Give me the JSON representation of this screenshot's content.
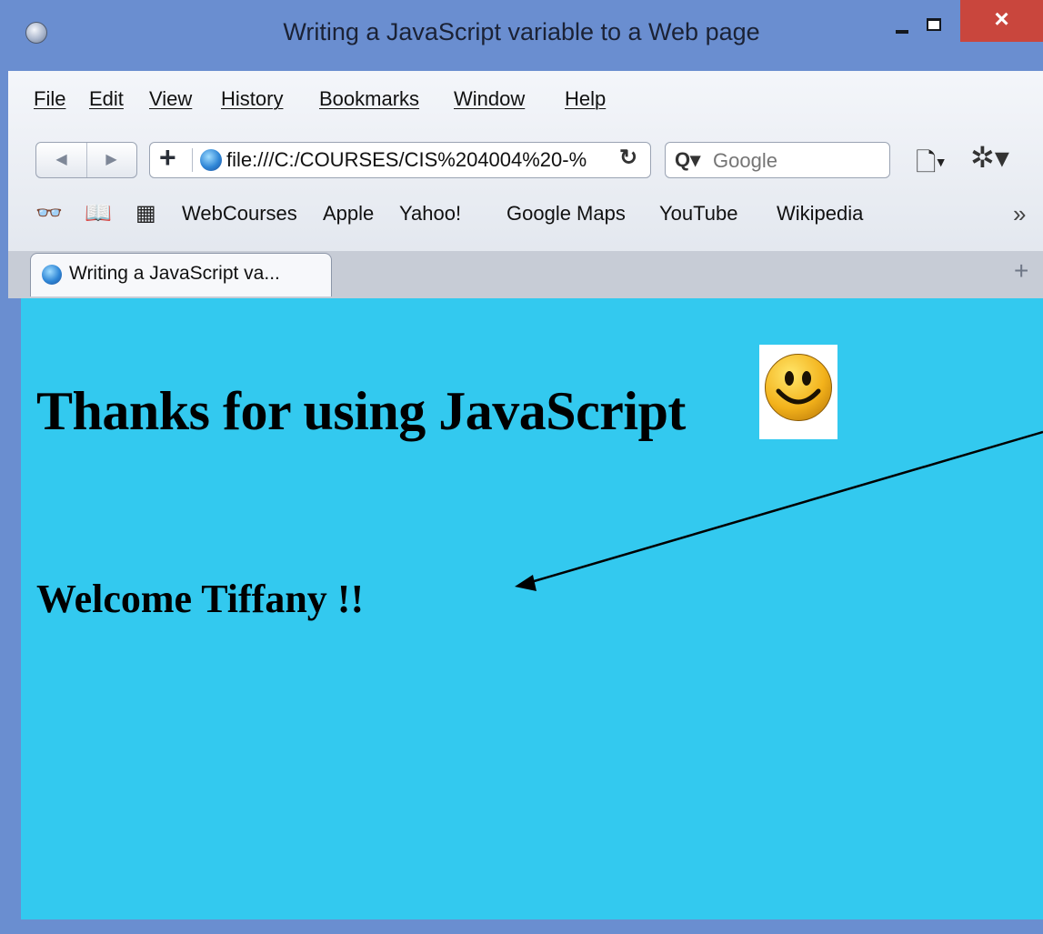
{
  "window": {
    "title": "Writing a JavaScript variable to a Web page",
    "close_label": "×"
  },
  "menu": [
    "File",
    "Edit",
    "View",
    "History",
    "Bookmarks",
    "Window",
    "Help"
  ],
  "nav": {
    "back_glyph": "◀",
    "forward_glyph": "▶",
    "add_glyph": "+",
    "url": "file:///C:/COURSES/CIS%204004%20-%",
    "reload_glyph": "↻",
    "search_placeholder": "Google",
    "search_glyph": "Q▾",
    "page_glyph": "🗋▾",
    "gear_glyph": "✲▾"
  },
  "bookmarks": {
    "items": [
      "WebCourses",
      "Apple",
      "Yahoo!",
      "Google Maps",
      "YouTube",
      "Wikipedia"
    ],
    "icons": [
      "reader-glasses-icon",
      "book-icon",
      "grid-icon"
    ],
    "overflow_glyph": "»"
  },
  "tabs": [
    {
      "label": "Writing a JavaScript va..."
    }
  ],
  "new_tab_glyph": "+",
  "page": {
    "heading": "Thanks for using JavaScript",
    "welcome": "Welcome Tiffany !!",
    "background": "#33c9ef"
  },
  "colors": {
    "window_frame": "#6a8ed0",
    "close_button": "#c9463d"
  }
}
